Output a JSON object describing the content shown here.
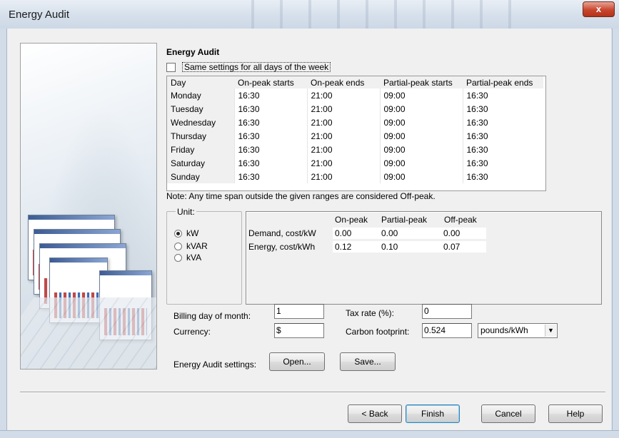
{
  "window": {
    "title": "Energy Audit",
    "close_glyph": "x"
  },
  "section_title": "Energy Audit",
  "same_settings": {
    "label": "Same settings for all days of the week",
    "checked": false
  },
  "schedule": {
    "headers": [
      "Day",
      "On-peak starts",
      "On-peak ends",
      "Partial-peak starts",
      "Partial-peak ends"
    ],
    "rows": [
      [
        "Monday",
        "16:30",
        "21:00",
        "09:00",
        "16:30"
      ],
      [
        "Tuesday",
        "16:30",
        "21:00",
        "09:00",
        "16:30"
      ],
      [
        "Wednesday",
        "16:30",
        "21:00",
        "09:00",
        "16:30"
      ],
      [
        "Thursday",
        "16:30",
        "21:00",
        "09:00",
        "16:30"
      ],
      [
        "Friday",
        "16:30",
        "21:00",
        "09:00",
        "16:30"
      ],
      [
        "Saturday",
        "16:30",
        "21:00",
        "09:00",
        "16:30"
      ],
      [
        "Sunday",
        "16:30",
        "21:00",
        "09:00",
        "16:30"
      ]
    ]
  },
  "note": "Note: Any time span outside the given ranges are considered Off-peak.",
  "unit": {
    "legend": "Unit:",
    "options": [
      {
        "label": "kW",
        "selected": true
      },
      {
        "label": "kVAR",
        "selected": false
      },
      {
        "label": "kVA",
        "selected": false
      }
    ]
  },
  "costs": {
    "headers": [
      "On-peak",
      "Partial-peak",
      "Off-peak"
    ],
    "demand": {
      "label": "Demand, cost/kW",
      "values": [
        "0.00",
        "0.00",
        "0.00"
      ]
    },
    "energy": {
      "label": "Energy, cost/kWh",
      "values": [
        "0.12",
        "0.10",
        "0.07"
      ]
    }
  },
  "billing": {
    "billing_day_label": "Billing day of month:",
    "billing_day_value": "1",
    "currency_label": "Currency:",
    "currency_value": "$",
    "tax_label": "Tax rate (%):",
    "tax_value": "0",
    "carbon_label": "Carbon footprint:",
    "carbon_value": "0.524",
    "carbon_unit": "pounds/kWh"
  },
  "settings": {
    "label": "Energy Audit settings:",
    "open": "Open...",
    "save": "Save..."
  },
  "footer": {
    "back": "< Back",
    "finish": "Finish",
    "cancel": "Cancel",
    "help": "Help"
  },
  "icons": {
    "dropdown": "chevron-down-icon",
    "close": "close-icon"
  }
}
